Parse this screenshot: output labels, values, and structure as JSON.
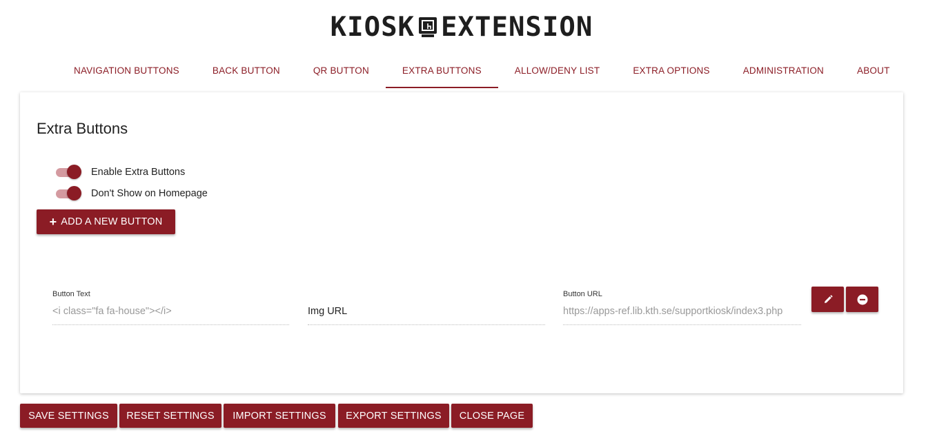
{
  "header": {
    "logo_left": "KIOSK",
    "logo_right": "EXTENSION"
  },
  "tabs": [
    {
      "label": "NAVIGATION BUTTONS"
    },
    {
      "label": "BACK BUTTON"
    },
    {
      "label": "QR BUTTON"
    },
    {
      "label": "EXTRA BUTTONS",
      "active": true
    },
    {
      "label": "ALLOW/DENY LIST"
    },
    {
      "label": "EXTRA OPTIONS"
    },
    {
      "label": "ADMINISTRATION"
    },
    {
      "label": "ABOUT"
    }
  ],
  "panel": {
    "title": "Extra Buttons",
    "toggles": [
      {
        "label": "Enable Extra Buttons",
        "checked": true
      },
      {
        "label": "Don't Show on Homepage",
        "checked": true
      }
    ],
    "add_button_label": "ADD A NEW BUTTON",
    "extra_button": {
      "button_text_label": "Button Text",
      "button_text_placeholder": "<i class=\"fa fa-house\"></i>",
      "img_url_value": "Img URL",
      "button_url_label": "Button URL",
      "button_url_placeholder": "https://apps-ref.lib.kth.se/supportkiosk/index3.php"
    }
  },
  "footer": {
    "save": "SAVE SETTINGS",
    "reset": "RESET SETTINGS",
    "import": "IMPORT SETTINGS",
    "export": "EXPORT SETTINGS",
    "close": "CLOSE PAGE"
  },
  "colors": {
    "accent": "#8b1c25",
    "toggle_track": "#d49aa0"
  },
  "icons": {
    "logo": "kiosk-touch-icon",
    "edit": "pencil-icon",
    "remove": "minus-circle-icon",
    "add": "plus-icon"
  }
}
